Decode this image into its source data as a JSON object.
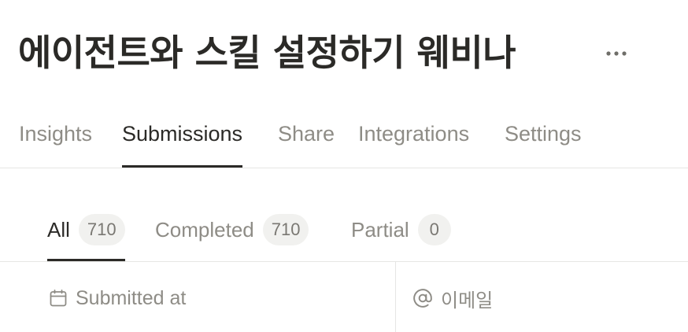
{
  "page": {
    "title": "에이전트와 스킬 설정하기 웨비나"
  },
  "header": {
    "more_icon": "more-horizontal-icon"
  },
  "tabs": [
    {
      "label": "Insights",
      "active": false
    },
    {
      "label": "Submissions",
      "active": true
    },
    {
      "label": "Share",
      "active": false
    },
    {
      "label": "Integrations",
      "active": false
    },
    {
      "label": "Settings",
      "active": false
    }
  ],
  "filters": [
    {
      "label": "All",
      "count": "710",
      "active": true
    },
    {
      "label": "Completed",
      "count": "710",
      "active": false
    },
    {
      "label": "Partial",
      "count": "0",
      "active": false
    }
  ],
  "columns": [
    {
      "label": "Submitted at",
      "icon": "calendar-icon"
    },
    {
      "label": "이메일",
      "icon": "at-sign-icon"
    }
  ],
  "colors": {
    "text_primary": "#2b2a27",
    "text_muted": "#8e8c86",
    "badge_bg": "#f1f1ef",
    "divider": "#e6e6e4"
  }
}
